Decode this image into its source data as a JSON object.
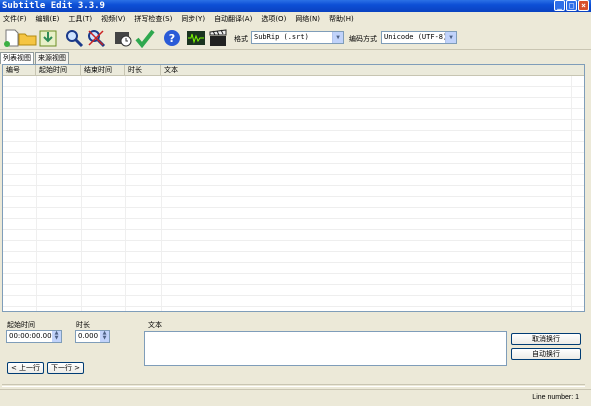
{
  "window": {
    "title": "Subtitle Edit 3.3.9",
    "controls": [
      "_",
      "□",
      "×"
    ]
  },
  "menu": [
    "文件(F)",
    "编辑(E)",
    "工具(T)",
    "视频(V)",
    "拼写检查(S)",
    "同步(Y)",
    "自动翻译(A)",
    "选项(O)",
    "网络(N)",
    "帮助(H)"
  ],
  "toolbar": {
    "buttons": [
      "new-file-icon",
      "open-folder-icon",
      "save-download-icon",
      "find-icon",
      "replace-icon",
      "visual-sync-icon",
      "spell-check-icon",
      "help-icon",
      "waveform-icon",
      "video-clapper-icon"
    ],
    "format_label": "格式",
    "format_value": "SubRip (.srt)",
    "encoding_label": "编码方式",
    "encoding_value": "Unicode (UTF-8)"
  },
  "tabs": [
    "列表视图",
    "来源视图"
  ],
  "table": {
    "columns": [
      "编号",
      "起始时间",
      "结束时间",
      "时长",
      "文本"
    ]
  },
  "editor": {
    "start_label": "起始时间",
    "start_value": "00:00:00.000",
    "duration_label": "时长",
    "duration_value": "0.000",
    "text_label": "文本",
    "prev_button": "< 上一行",
    "next_button": "下一行 >",
    "unbreak_button": "取消换行",
    "autobreak_button": "自动换行"
  },
  "status": {
    "line_number": "Line number: 1"
  },
  "colors": {
    "titlebar": "#0d4fd6",
    "window_bg": "#ece9d8",
    "border": "#7f9db9"
  }
}
